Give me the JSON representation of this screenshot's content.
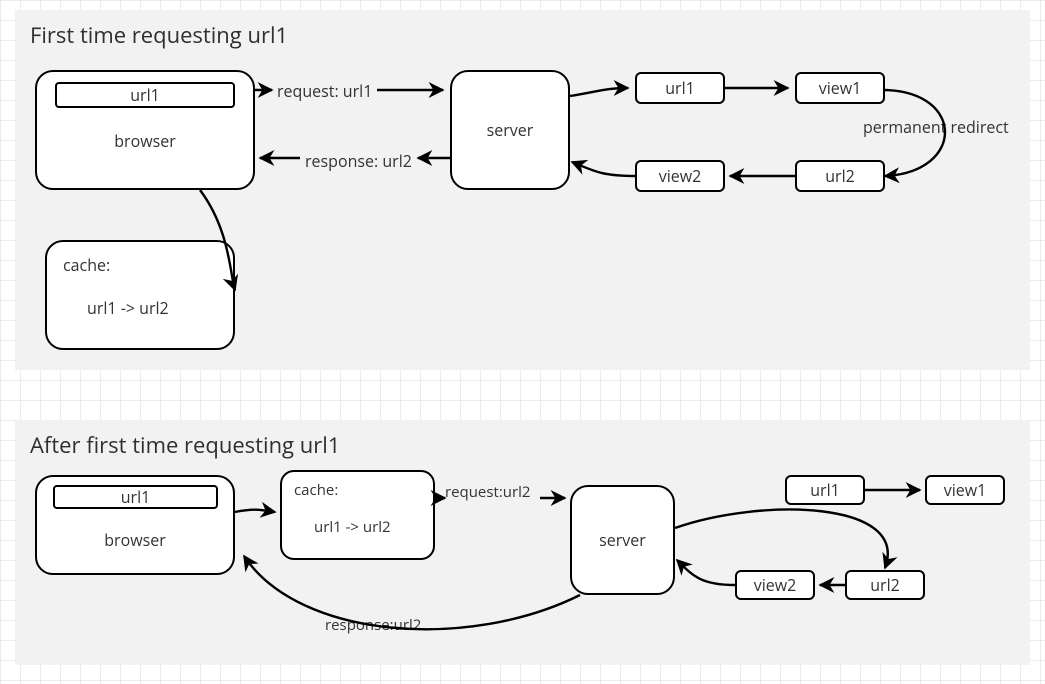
{
  "diagram1": {
    "title": "First time requesting url1",
    "browser": {
      "label": "browser",
      "address": "url1"
    },
    "server": {
      "label": "server"
    },
    "cache": {
      "header": "cache:",
      "mapping": "url1 -> url2"
    },
    "nodes": {
      "url1": "url1",
      "view1": "view1",
      "url2": "url2",
      "view2": "view2"
    },
    "edges": {
      "request": "request: url1",
      "response": "response: url2",
      "redirect": "permanent redirect"
    }
  },
  "diagram2": {
    "title": "After first time requesting url1",
    "browser": {
      "label": "browser",
      "address": "url1"
    },
    "server": {
      "label": "server"
    },
    "cache": {
      "header": "cache:",
      "mapping": "url1 -> url2"
    },
    "nodes": {
      "url1": "url1",
      "view1": "view1",
      "url2": "url2",
      "view2": "view2"
    },
    "edges": {
      "request": "request:url2",
      "response": "response:url2"
    }
  }
}
